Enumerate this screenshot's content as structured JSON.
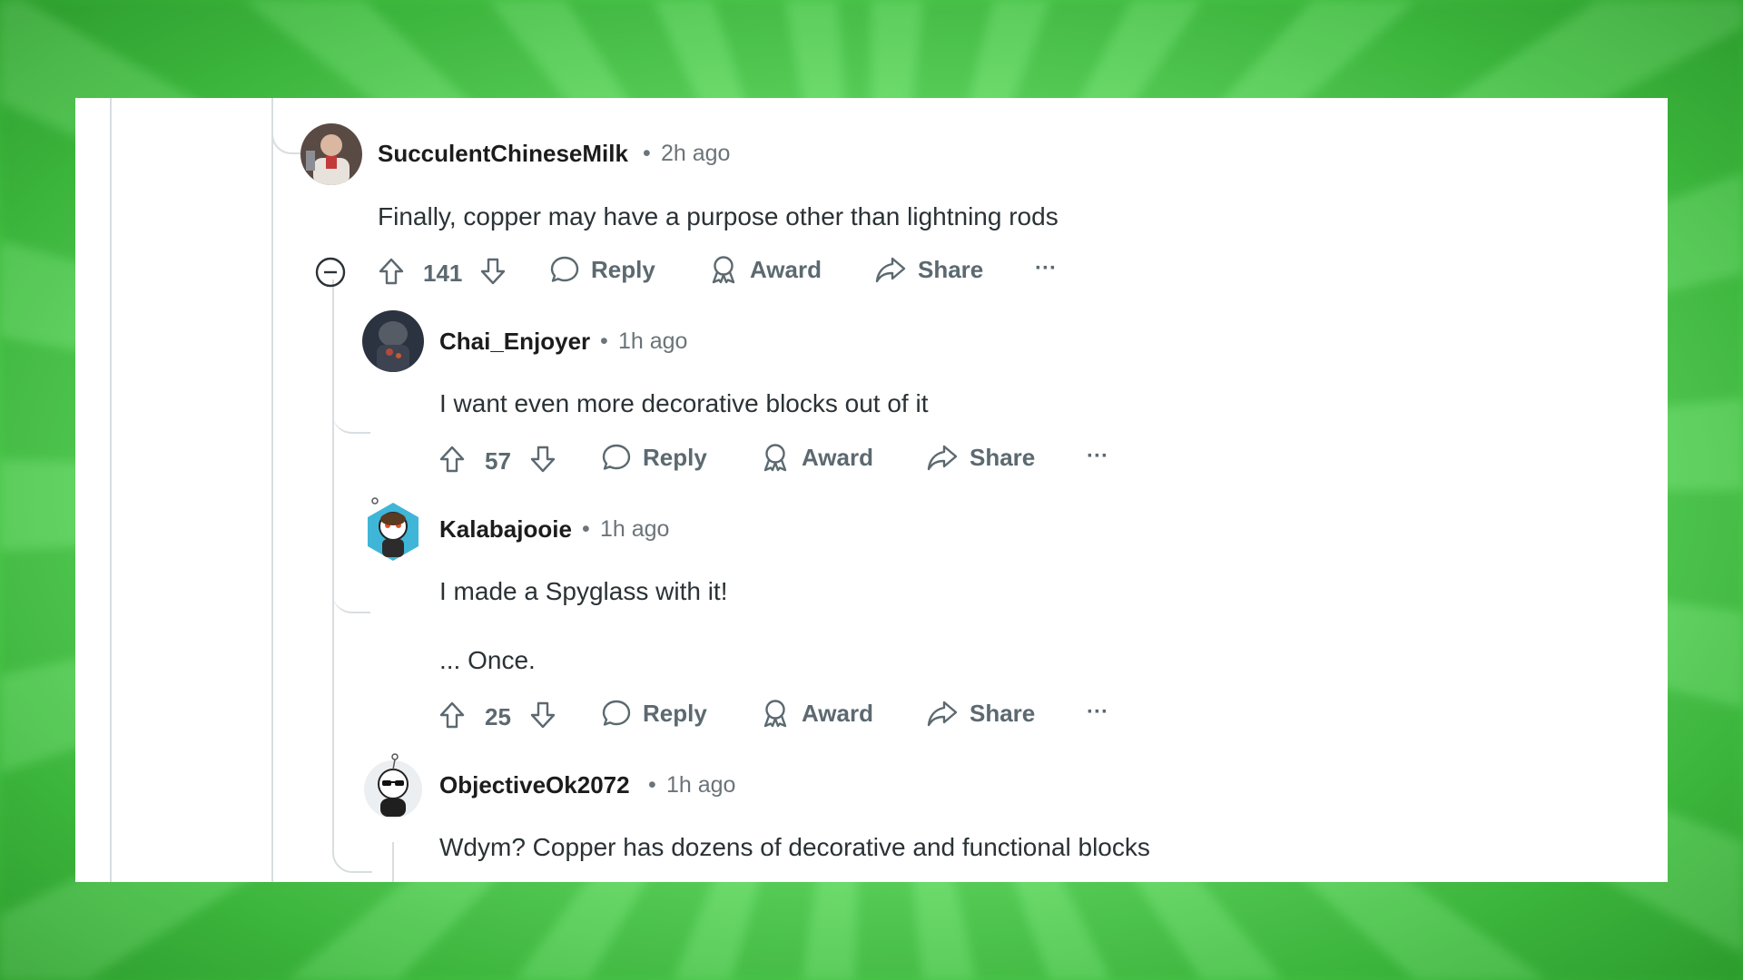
{
  "comments": [
    {
      "username": "SucculentChineseMilk",
      "separator": "•",
      "time": "2h ago",
      "body": [
        "Finally, copper may have a purpose other than lightning rods"
      ],
      "votes": "141",
      "avatar_icon": "user-avatar-photo"
    },
    {
      "username": "Chai_Enjoyer",
      "separator": "•",
      "time": "1h ago",
      "body": [
        "I want even more decorative blocks out of it"
      ],
      "votes": "57",
      "avatar_icon": "user-avatar-photo"
    },
    {
      "username": "Kalabajooie",
      "separator": "•",
      "time": "1h ago",
      "body": [
        "I made a Spyglass with it!",
        "... Once."
      ],
      "votes": "25",
      "avatar_icon": "snoo-avatar"
    },
    {
      "username": "ObjectiveOk2072",
      "separator": "•",
      "time": "1h ago",
      "body": [
        "Wdym? Copper has dozens of decorative and functional blocks"
      ],
      "avatar_icon": "snoo-avatar"
    }
  ],
  "actions": {
    "reply": "Reply",
    "award": "Award",
    "share": "Share",
    "more": "···"
  },
  "colors": {
    "background_green": "#6fe86f",
    "panel": "#ffffff",
    "thread_line": "#d8dde0",
    "text_primary": "#1c1c1c",
    "text_muted": "#6b7479"
  }
}
